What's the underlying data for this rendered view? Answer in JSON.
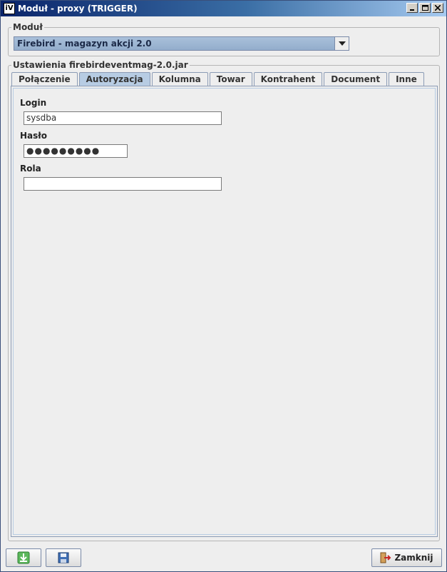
{
  "window": {
    "title": "Moduł - proxy (TRIGGER)",
    "icon_text": "iV",
    "icon": "app-icon"
  },
  "module_group": {
    "legend": "Moduł",
    "selected": "Firebird - magazyn akcji 2.0"
  },
  "settings_group": {
    "legend": "Ustawienia firebirdeventmag-2.0.jar"
  },
  "tabs": [
    {
      "label": "Połączenie",
      "active": false
    },
    {
      "label": "Autoryzacja",
      "active": true
    },
    {
      "label": "Kolumna",
      "active": false
    },
    {
      "label": "Towar",
      "active": false
    },
    {
      "label": "Kontrahent",
      "active": false
    },
    {
      "label": "Document",
      "active": false
    },
    {
      "label": "Inne",
      "active": false
    }
  ],
  "form": {
    "login_label": "Login",
    "login_value": "sysdba",
    "password_label": "Hasło",
    "password_value": "●●●●●●●●●",
    "role_label": "Rola",
    "role_value": ""
  },
  "footer": {
    "import_icon": "download-icon",
    "save_icon": "save-icon",
    "close_label": "Zamknij",
    "close_icon": "exit-icon"
  },
  "colors": {
    "titlebar_start": "#0a246a",
    "titlebar_end": "#a6caf0",
    "active_tab": "#b7cce3",
    "selected_combo": "#93adcc"
  }
}
